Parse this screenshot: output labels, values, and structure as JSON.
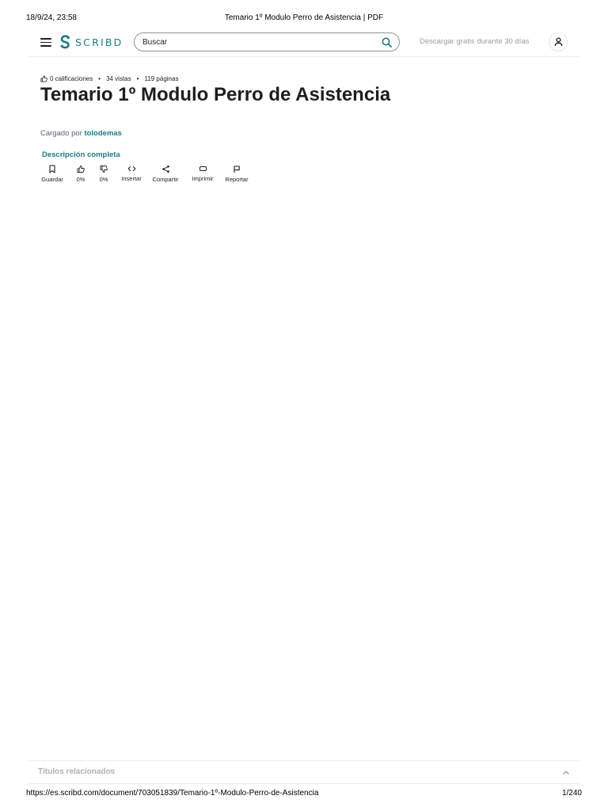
{
  "print": {
    "date": "18/9/24, 23:58",
    "title": "Temario 1º Modulo Perro de Asistencia | PDF",
    "url": "https://es.scribd.com/document/703051839/Temario-1º-Modulo-Perro-de-Asistencia",
    "page": "1/240"
  },
  "header": {
    "logo_text": "SCRIBD",
    "search_placeholder": "Buscar",
    "trial_link": "Descargar gratis durante 30 días",
    "brand_color": "#1e7b85"
  },
  "document": {
    "meta": {
      "ratings": "0 calificaciones",
      "views": "34 vistas",
      "pages": "119 páginas"
    },
    "title": "Temario 1º Modulo Perro de Asistencia",
    "uploaded_prefix": "Cargado por",
    "author": "tolodemas",
    "description_link": "Descripción completa",
    "actions": [
      {
        "label": "Guardar",
        "icon": "bookmark-icon"
      },
      {
        "label": "0%",
        "icon": "thumbs-up-icon"
      },
      {
        "label": "0%",
        "icon": "thumbs-down-icon"
      },
      {
        "label": "Insertar",
        "icon": "code-icon"
      },
      {
        "label": "Compartir",
        "icon": "share-icon"
      },
      {
        "label": "Imprimir",
        "icon": "print-icon"
      },
      {
        "label": "Reportar",
        "icon": "flag-icon"
      }
    ]
  },
  "related": {
    "label": "Títulos relacionados"
  }
}
